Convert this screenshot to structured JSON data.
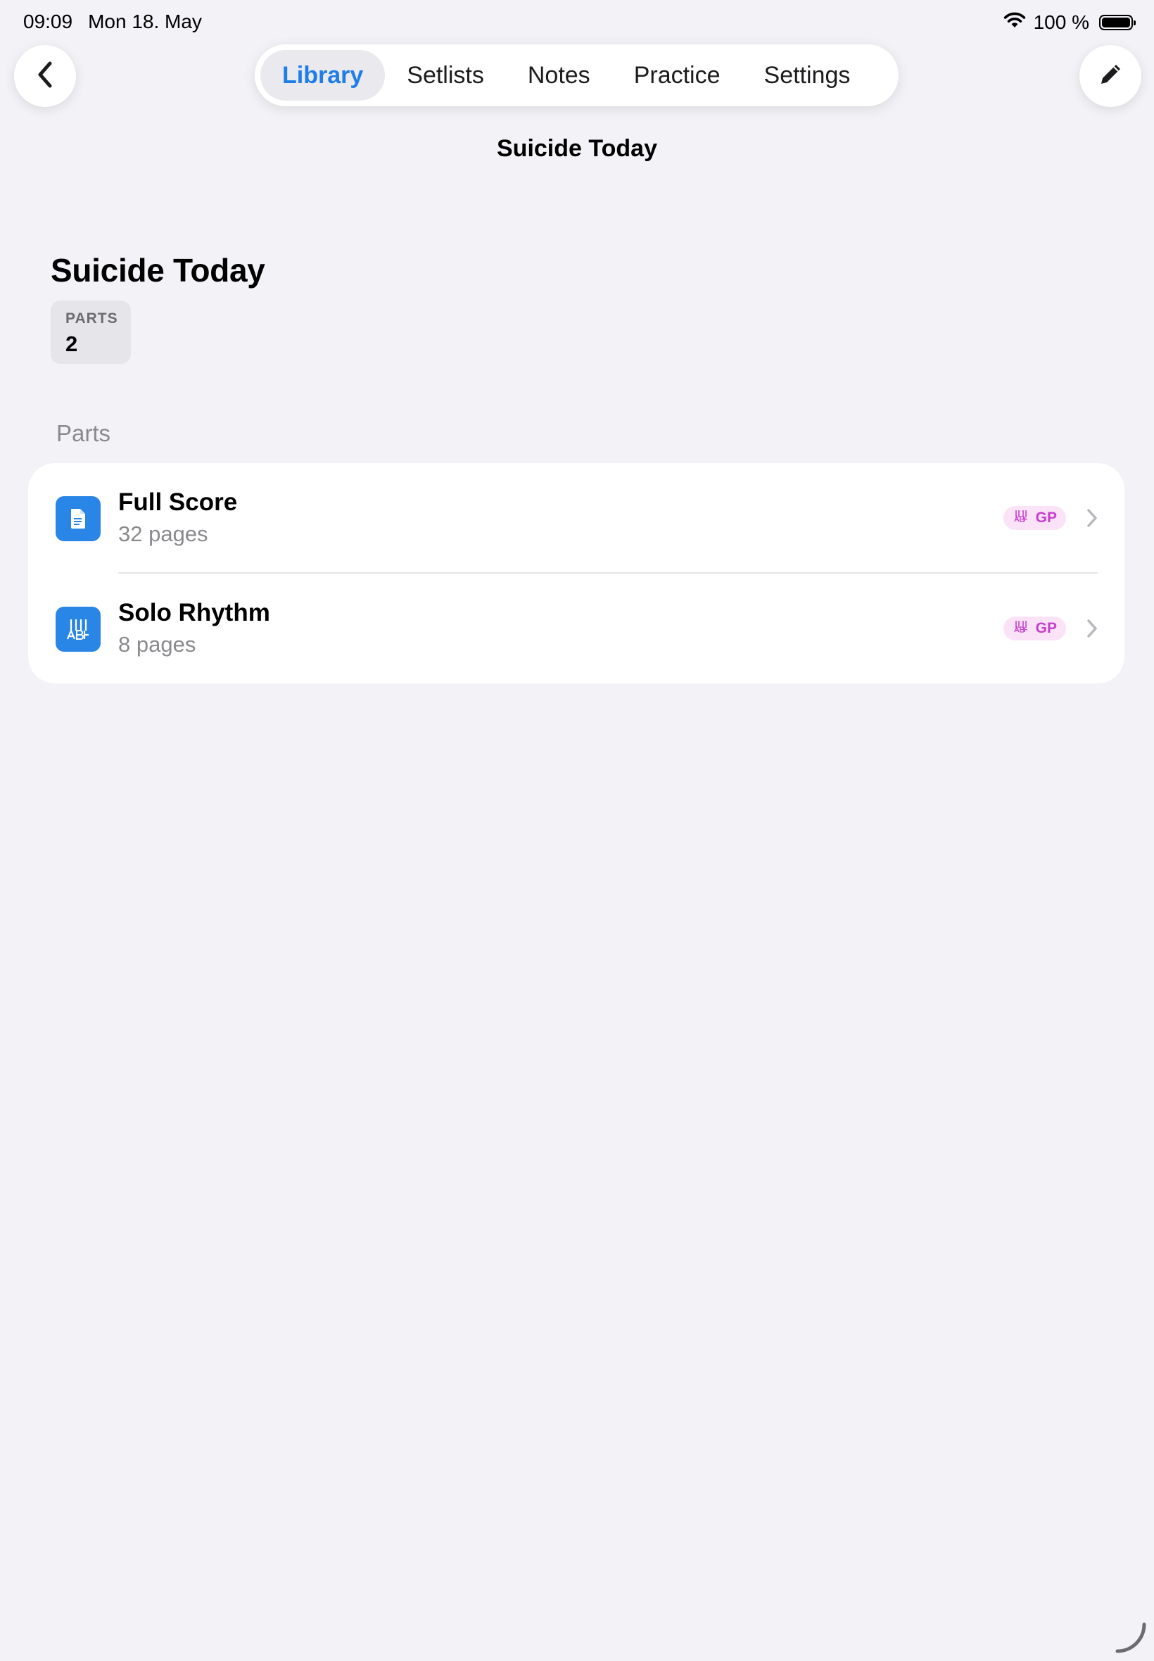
{
  "status_bar": {
    "time": "09:09",
    "date": "Mon 18. May",
    "battery": "100 %",
    "battery_level": 1.0
  },
  "nav": {
    "back_icon": "chevron-left-icon",
    "edit_icon": "pencil-icon",
    "tabs": [
      {
        "label": "Library",
        "active": true
      },
      {
        "label": "Setlists",
        "active": false
      },
      {
        "label": "Notes",
        "active": false
      },
      {
        "label": "Practice",
        "active": false
      },
      {
        "label": "Settings",
        "active": false
      }
    ],
    "title": "Suicide Today"
  },
  "song": {
    "title": "Suicide Today",
    "stat": {
      "label": "PARTS",
      "value": "2"
    }
  },
  "parts_section": {
    "header": "Parts",
    "items": [
      {
        "title": "Full Score",
        "subtitle": "32 pages",
        "badge": "GP",
        "icon": "document-icon"
      },
      {
        "title": "Solo Rhythm",
        "subtitle": "8 pages",
        "badge": "GP",
        "icon": "tablature-icon"
      }
    ]
  },
  "colors": {
    "accent": "#1f7de8",
    "background": "#f2f2f7",
    "badge_text": "#c73fcd",
    "badge_bg": "#fbe3f7",
    "icon_bg": "#2a86e6"
  }
}
